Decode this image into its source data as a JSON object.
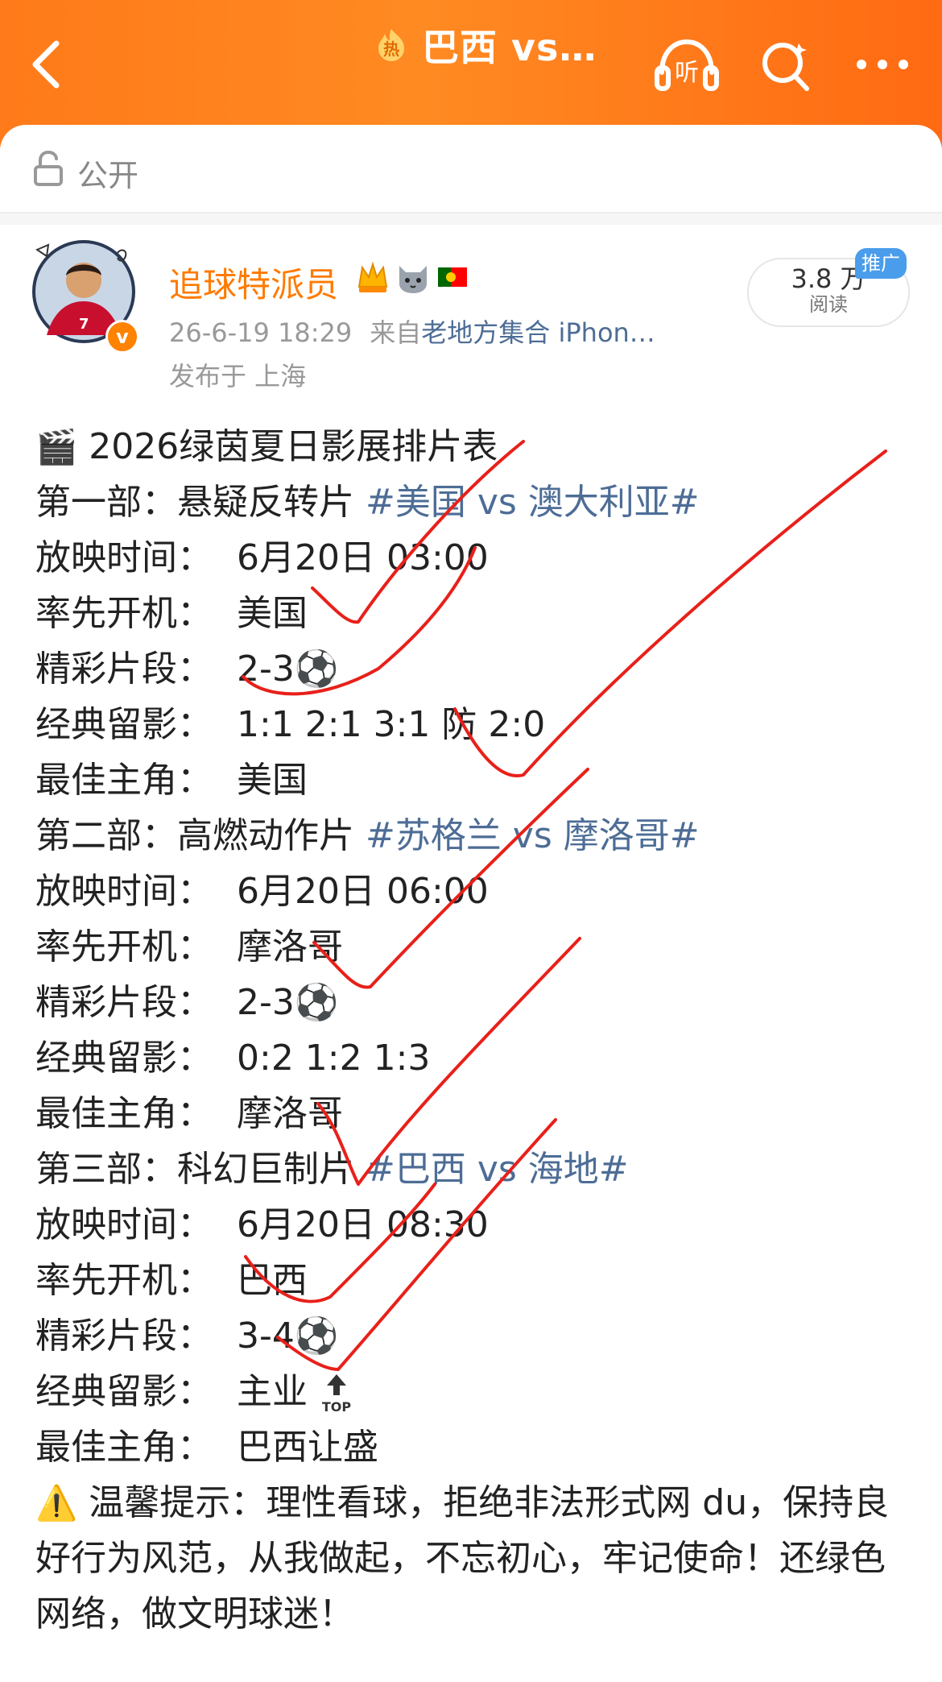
{
  "header": {
    "title": "巴西 vs…",
    "hot_badge": "热",
    "listen_label": "听",
    "icons": {
      "back": "chevron-left-icon",
      "listen": "headphones-icon",
      "search": "search-icon",
      "more": "more-icon"
    }
  },
  "visibility": {
    "label": "公开"
  },
  "post": {
    "author": "追球特派员",
    "time": "26-6-19 18:29",
    "source_prefix": "来自",
    "source": "老地方集合 iPhon…",
    "location": "发布于 上海",
    "verify_mark": "v",
    "reads": {
      "count": "3.8 万",
      "label": "阅读"
    },
    "promo": "推广",
    "content": {
      "title_emoji": "🎬",
      "title": "2026绿茵夏日影展排片表",
      "sections": [
        {
          "header": "第一部：悬疑反转片",
          "hashtag": "#美国 vs 澳大利亚#",
          "rows": [
            {
              "label": "放映时间：",
              "value": "6月20日 03:00"
            },
            {
              "label": "率先开机：",
              "value": "美国"
            },
            {
              "label": "精彩片段：",
              "value": "2-3⚽"
            },
            {
              "label": "经典留影：",
              "value": "1:1  2:1  3:1  防 2:0"
            },
            {
              "label": "最佳主角：",
              "value": "美国"
            }
          ]
        },
        {
          "header": "第二部：高燃动作片",
          "hashtag": "#苏格兰 vs 摩洛哥#",
          "rows": [
            {
              "label": "放映时间：",
              "value": "6月20日 06:00"
            },
            {
              "label": "率先开机：",
              "value": "摩洛哥"
            },
            {
              "label": "精彩片段：",
              "value": "2-3⚽"
            },
            {
              "label": "经典留影：",
              "value": "0:2  1:2  1:3"
            },
            {
              "label": "最佳主角：",
              "value": "摩洛哥"
            }
          ]
        },
        {
          "header": "第三部：科幻巨制片",
          "hashtag": "#巴西 vs 海地#",
          "rows": [
            {
              "label": "放映时间：",
              "value": "6月20日 08:30"
            },
            {
              "label": "率先开机：",
              "value": "巴西"
            },
            {
              "label": "精彩片段：",
              "value": "3-4⚽"
            },
            {
              "label": "经典留影：",
              "value": "主业"
            },
            {
              "label": "最佳主角：",
              "value": "巴西让盛"
            }
          ]
        }
      ],
      "top_icon_label": "TOP",
      "note_emoji": "⚠️",
      "note": "温馨提示：理性看球，拒绝非法形式网 du，保持良好行为风范，从我做起，不忘初心，牢记使命！还绿色网络，做文明球迷！"
    }
  },
  "colors": {
    "header": "#ff7a1a",
    "username": "#ff7a00",
    "link": "#4d6d96",
    "scribble": "#e8201a"
  }
}
